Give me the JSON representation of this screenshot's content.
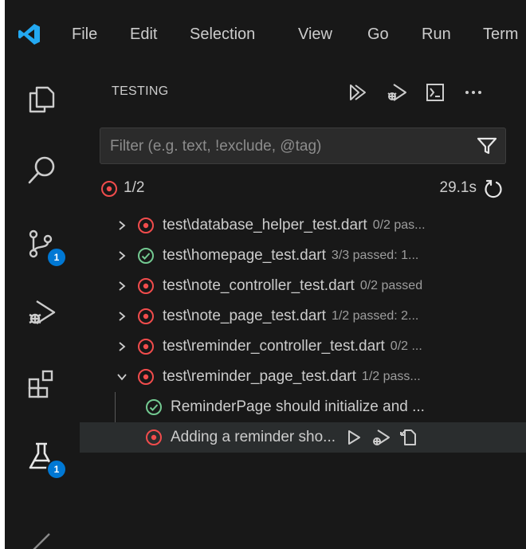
{
  "menu": {
    "logo_icon": "vscode-logo-icon",
    "items": [
      "File",
      "Edit",
      "Selection",
      "View",
      "Go",
      "Run",
      "Term"
    ]
  },
  "activity_bar": {
    "items": [
      {
        "icon": "explorer-icon"
      },
      {
        "icon": "search-icon"
      },
      {
        "icon": "source-control-icon",
        "badge": "1"
      },
      {
        "icon": "run-debug-icon"
      },
      {
        "icon": "extensions-icon"
      },
      {
        "icon": "testing-icon",
        "badge": "1"
      }
    ],
    "accent": "#0078d4"
  },
  "testing": {
    "title": "TESTING",
    "actions": [
      "run-all-tests-icon",
      "debug-all-tests-icon",
      "terminal-icon",
      "more-actions-icon"
    ],
    "filter_placeholder": "Filter (e.g. text, !exclude, @tag)",
    "summary": {
      "count": "1/2",
      "duration": "29.1s"
    },
    "colors": {
      "failed": "#f14c4c",
      "passed": "#73c991"
    },
    "items": [
      {
        "name": "test\\database_helper_test.dart",
        "desc": "0/2 pas...",
        "status": "failed",
        "expanded": false
      },
      {
        "name": "test\\homepage_test.dart",
        "desc": "3/3 passed: 1...",
        "status": "passed",
        "expanded": false
      },
      {
        "name": "test\\note_controller_test.dart",
        "desc": "0/2 passed",
        "status": "failed",
        "expanded": false
      },
      {
        "name": "test\\note_page_test.dart",
        "desc": "1/2 passed: 2...",
        "status": "failed",
        "expanded": false
      },
      {
        "name": "test\\reminder_controller_test.dart",
        "desc": "0/2 ...",
        "status": "failed",
        "expanded": false
      },
      {
        "name": "test\\reminder_page_test.dart",
        "desc": "1/2 pass...",
        "status": "failed",
        "expanded": true
      }
    ],
    "children": [
      {
        "name": "ReminderPage should initialize and ...",
        "status": "passed"
      },
      {
        "name": "Adding a reminder sho...",
        "status": "failed",
        "selected": true
      }
    ],
    "row_actions": [
      "run-test-icon",
      "debug-test-icon",
      "go-to-test-icon"
    ]
  }
}
